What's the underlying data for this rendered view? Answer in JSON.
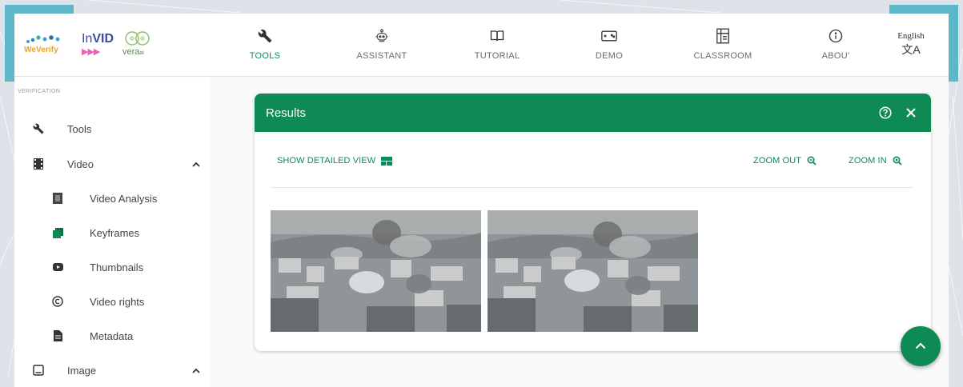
{
  "logo": {
    "weverify": "WeVerify",
    "invid_prefix": "In",
    "invid_bold": "VID",
    "vera": "vera",
    "vera_suffix": "ai"
  },
  "nav": [
    {
      "label": "TOOLS",
      "icon": "wrench-icon",
      "active": true
    },
    {
      "label": "ASSISTANT",
      "icon": "robot-icon",
      "active": false
    },
    {
      "label": "TUTORIAL",
      "icon": "book-icon",
      "active": false
    },
    {
      "label": "DEMO",
      "icon": "gamepad-icon",
      "active": false
    },
    {
      "label": "CLASSROOM",
      "icon": "classroom-icon",
      "active": false
    },
    {
      "label": "ABOU'",
      "icon": "info-icon",
      "active": false
    }
  ],
  "language": {
    "label": "English",
    "icon": "translate-icon"
  },
  "sidebar": {
    "section_label": "VERIFICATION",
    "items": [
      {
        "label": "Tools",
        "icon": "wrench-icon"
      },
      {
        "label": "Video",
        "icon": "film-icon",
        "expanded": true
      },
      {
        "label": "Video Analysis",
        "icon": "video-analysis-icon"
      },
      {
        "label": "Keyframes",
        "icon": "keyframes-icon",
        "active": true
      },
      {
        "label": "Thumbnails",
        "icon": "youtube-icon"
      },
      {
        "label": "Video rights",
        "icon": "copyright-icon"
      },
      {
        "label": "Metadata",
        "icon": "file-icon"
      },
      {
        "label": "Image",
        "icon": "image-icon",
        "expanded": true
      }
    ]
  },
  "results": {
    "title": "Results",
    "show_detailed_view": "SHOW DETAILED VIEW",
    "zoom_out": "ZOOM OUT",
    "zoom_in": "ZOOM IN",
    "keyframes_count": 2
  },
  "colors": {
    "accent": "#0e8a56",
    "header_bg": "#0e8a56",
    "corner_accent": "#5cb8c8"
  }
}
